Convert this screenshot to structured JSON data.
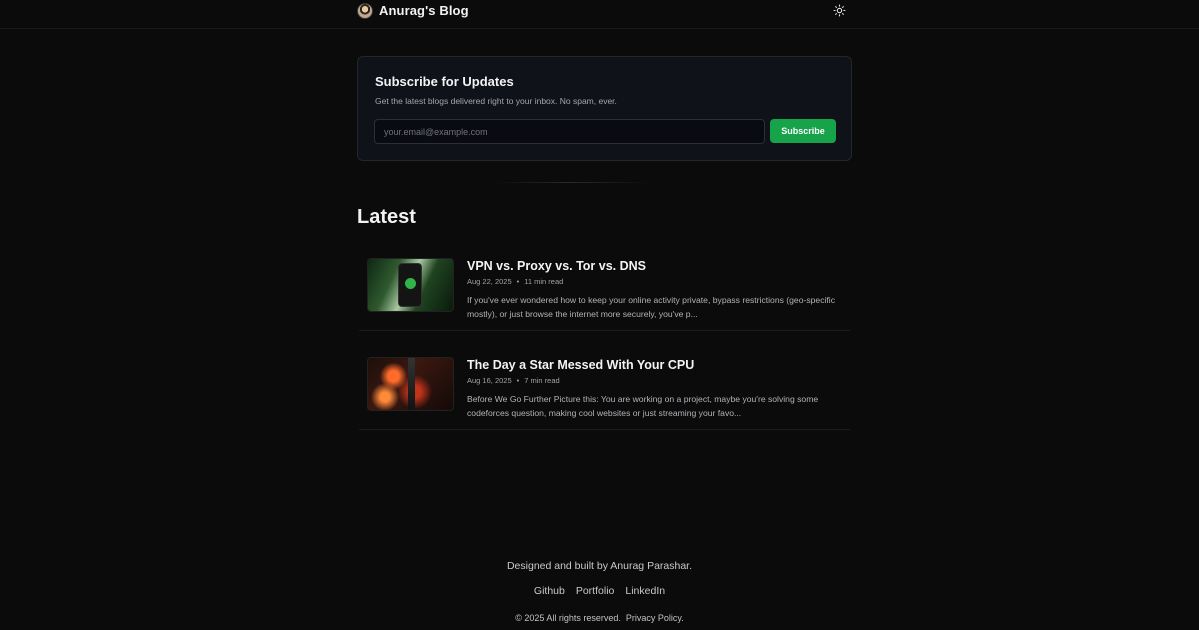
{
  "header": {
    "brand_name": "Anurag's Blog",
    "avatar_icon": "avatar",
    "theme_icon": "sun-icon"
  },
  "subscribe": {
    "title": "Subscribe for Updates",
    "description": "Get the latest blogs delivered right to your inbox. No spam, ever.",
    "email_placeholder": "your.email@example.com",
    "email_value": "",
    "button_label": "Subscribe",
    "accent_color": "#16a34a"
  },
  "latest": {
    "heading": "Latest",
    "posts": [
      {
        "title": "VPN vs. Proxy vs. Tor vs. DNS",
        "date": "Aug 22, 2025",
        "read_time": "11 min read",
        "excerpt": "If you've ever wondered how to keep your online activity private, bypass restrictions (geo-specific mostly), or just browse the internet more securely, you've p..."
      },
      {
        "title": "The Day a Star Messed With Your CPU",
        "date": "Aug 16, 2025",
        "read_time": "7 min read",
        "excerpt": "Before We Go Further Picture this: You are working on a project, maybe you're solving some codeforces question, making cool websites or just streaming your favo..."
      }
    ]
  },
  "footer": {
    "credit": "Designed and built by Anurag Parashar.",
    "links": [
      "Github",
      "Portfolio",
      "LinkedIn"
    ],
    "copyright": "© 2025 All rights reserved.",
    "privacy": "Privacy Policy."
  }
}
